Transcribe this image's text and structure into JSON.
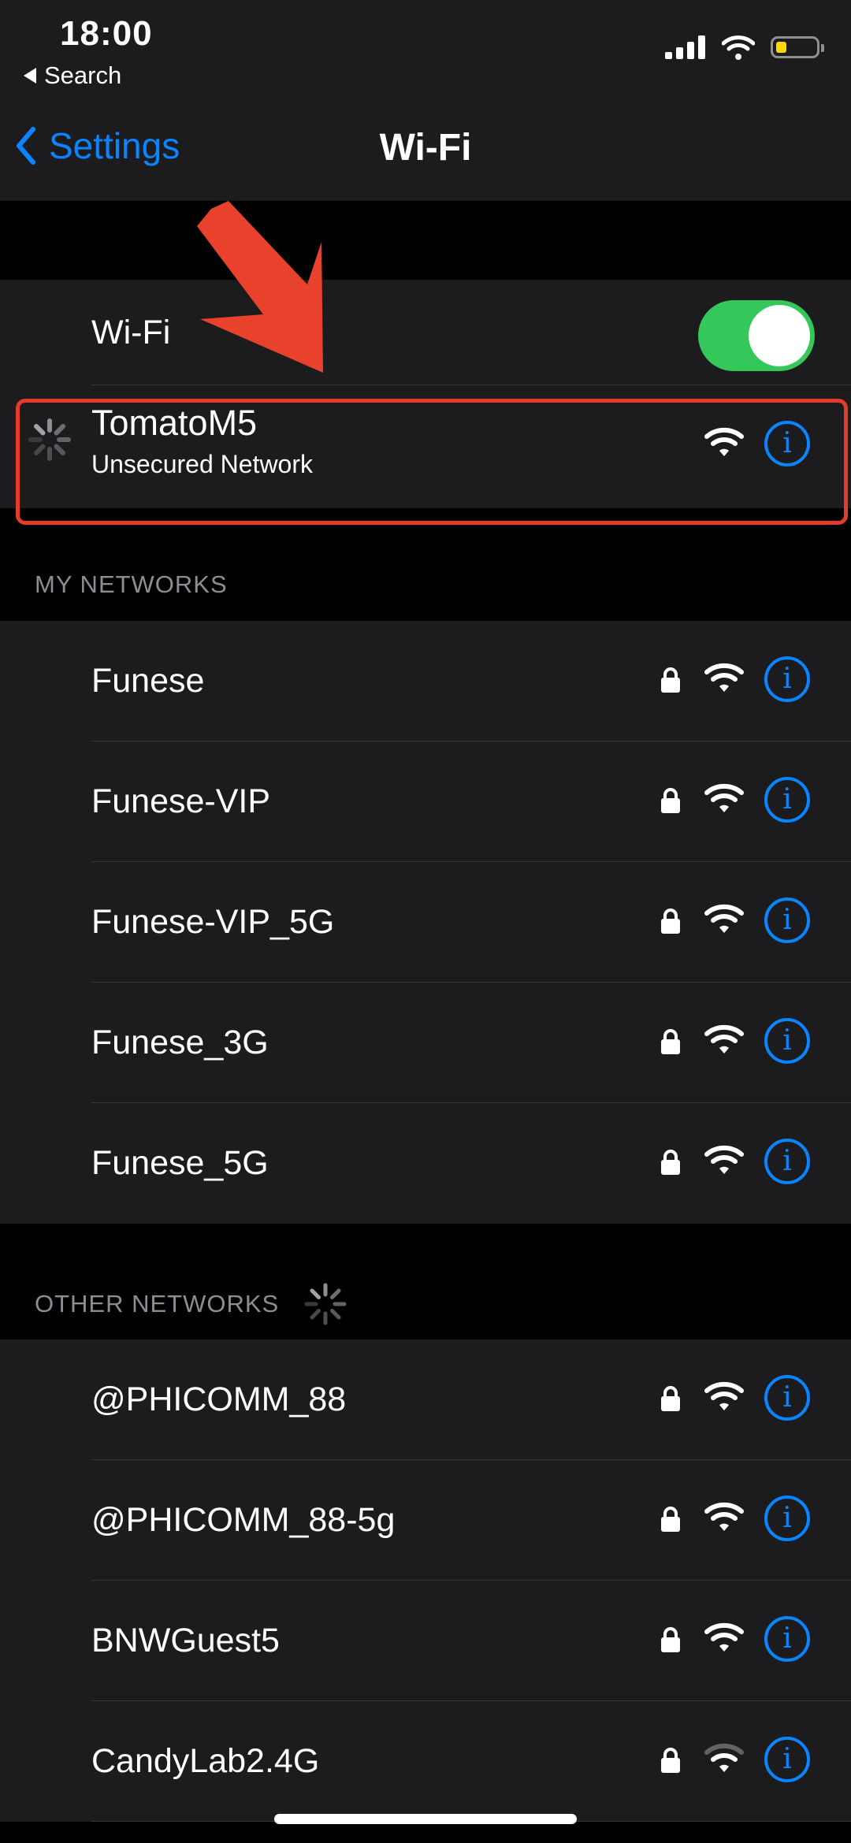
{
  "status_bar": {
    "time": "18:00",
    "back_app": "Search"
  },
  "nav": {
    "back_label": "Settings",
    "title": "Wi-Fi"
  },
  "wifi_toggle": {
    "label": "Wi-Fi",
    "on": true
  },
  "current_network": {
    "name": "TomatoM5",
    "subtitle": "Unsecured Network"
  },
  "my_networks": {
    "header": "MY NETWORKS",
    "items": [
      {
        "label": "Funese",
        "locked": true
      },
      {
        "label": "Funese-VIP",
        "locked": true
      },
      {
        "label": "Funese-VIP_5G",
        "locked": true
      },
      {
        "label": "Funese_3G",
        "locked": true
      },
      {
        "label": "Funese_5G",
        "locked": true
      }
    ]
  },
  "other_networks": {
    "header": "OTHER NETWORKS",
    "items": [
      {
        "label": "@PHICOMM_88",
        "locked": true
      },
      {
        "label": "@PHICOMM_88-5g",
        "locked": true
      },
      {
        "label": "BNWGuest5",
        "locked": true
      },
      {
        "label": "CandyLab2.4G",
        "locked": true
      }
    ]
  },
  "info_glyph": "i",
  "colors": {
    "accent": "#0a84ff",
    "toggle_on": "#34c759",
    "highlight": "#e43b2a",
    "arrow": "#e8412c"
  }
}
